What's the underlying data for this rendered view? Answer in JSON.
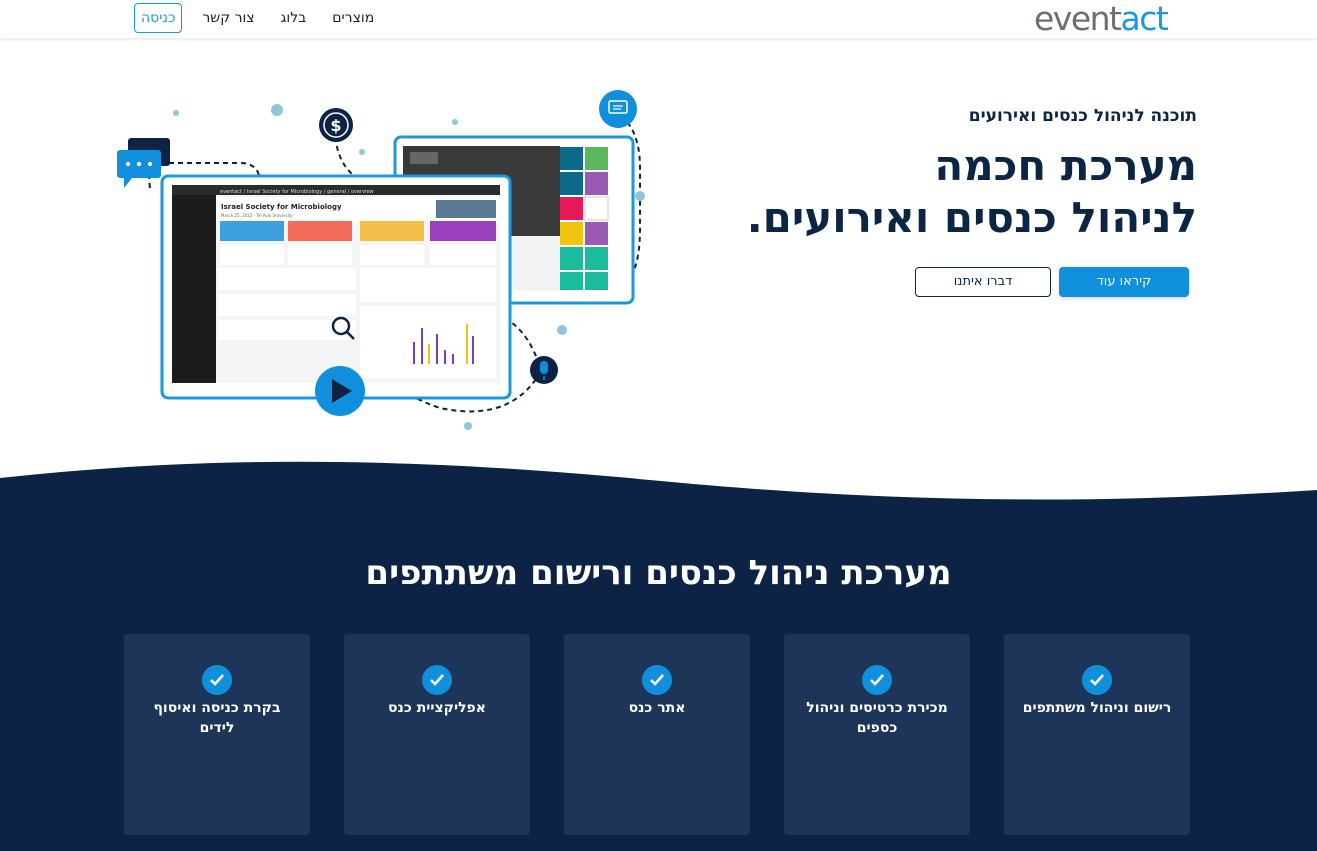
{
  "nav": {
    "logo_prefix": "event",
    "logo_suffix": "act",
    "links": [
      "מוצרים",
      "בלוג",
      "צור קשר"
    ],
    "login_label": "כניסה"
  },
  "hero": {
    "subtitle": "תוכנה לניהול כנסים ואירועים",
    "title_line1": "מערכת חכמה",
    "title_line2": "לניהול כנסים ואירועים.",
    "primary_button": "קיראו עוד",
    "secondary_button": "דברו איתנו"
  },
  "mockup": {
    "header": "eventact / Israel Society for Microbiology / general / overview",
    "title": "Israel Society for Microbiology",
    "date": "March 25, 2022 - Tel Aviv University"
  },
  "features": {
    "title": "מערכת ניהול כנסים ורישום משתתפים",
    "cards": [
      "רישום וניהול משתתפים",
      "מכירת כרטיסים וניהול כספים",
      "אתר כנס",
      "אפליקציית כנס",
      "בקרת כניסה ואיסוף לידים"
    ]
  },
  "colors": {
    "brand_blue": "#1a9ad9",
    "brand_gray": "#6b6f73",
    "dark_navy": "#0d2345",
    "card_bg": "#1d3558",
    "button_blue": "#0f8fdc"
  }
}
